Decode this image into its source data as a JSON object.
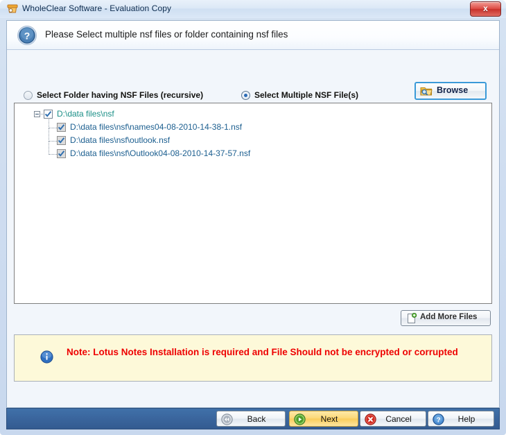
{
  "window": {
    "title": "WholeClear Software - Evaluation Copy",
    "title_icon": "app-box-icon",
    "close_label": "x"
  },
  "header": {
    "icon": "question-circle-icon",
    "text": "Please Select multiple nsf files or folder containing nsf files"
  },
  "options": {
    "folder": {
      "label": "Select Folder having NSF Files (recursive)",
      "selected": false
    },
    "files": {
      "label": "Select Multiple NSF File(s)",
      "selected": true
    },
    "browse": {
      "label": "Browse",
      "icon": "folder-search-icon"
    }
  },
  "tree": {
    "root": {
      "label": "D:\\data files\\nsf",
      "checked": true,
      "expanded": true
    },
    "children": [
      {
        "label": "D:\\data files\\nsf\\names04-08-2010-14-38-1.nsf",
        "checked": true
      },
      {
        "label": "D:\\data files\\nsf\\outlook.nsf",
        "checked": true
      },
      {
        "label": "D:\\data files\\nsf\\Outlook04-08-2010-14-37-57.nsf",
        "checked": true
      }
    ]
  },
  "add_more": {
    "label": "Add More Files",
    "icon": "document-add-icon"
  },
  "note": {
    "icon": "info-circle-icon",
    "text": "Note: Lotus Notes Installation is required and File Should not be encrypted or corrupted",
    "color": "#ee0000",
    "background": "#fdf9d9"
  },
  "footer": {
    "buttons": [
      {
        "label": "Back",
        "icon": "rewind-circle-icon",
        "highlighted": false
      },
      {
        "label": "Next",
        "icon": "play-circle-icon",
        "highlighted": true
      },
      {
        "label": "Cancel",
        "icon": "cancel-circle-icon",
        "highlighted": false
      },
      {
        "label": "Help",
        "icon": "help-circle-icon",
        "highlighted": false
      }
    ],
    "background": "#3a659d"
  }
}
